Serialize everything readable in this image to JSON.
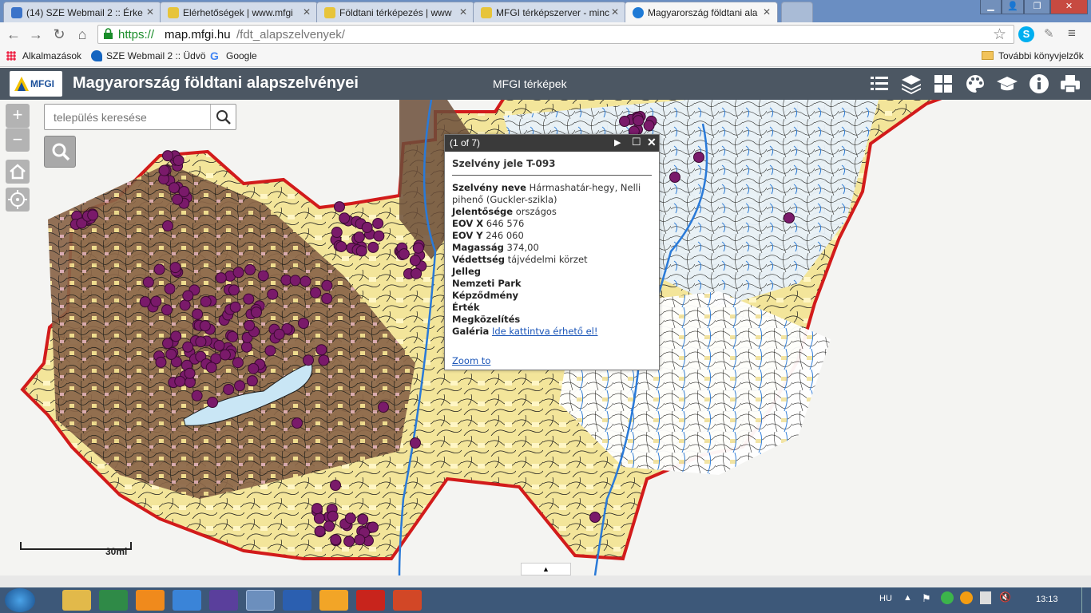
{
  "browser": {
    "tabs": [
      {
        "title": "(14) SZE Webmail 2 :: Érke",
        "active": false
      },
      {
        "title": "Elérhetőségek | www.mfgi",
        "active": false
      },
      {
        "title": "Földtani térképezés | www",
        "active": false
      },
      {
        "title": "MFGI térképszerver - minc",
        "active": false
      },
      {
        "title": "Magyarország földtani ala",
        "active": true
      }
    ],
    "url_scheme": "https://",
    "url_host": "map.mfgi.hu",
    "url_path": "/fdt_alapszelvenyek/",
    "bookmarks": [
      {
        "label": "Alkalmazások"
      },
      {
        "label": "SZE Webmail 2 :: Üdvö"
      },
      {
        "label": "Google"
      }
    ],
    "other_bookmarks": "További könyvjelzők"
  },
  "app": {
    "logo_text": "MFGI",
    "title": "Magyarország földtani alapszelvényei",
    "nav_link": "MFGI térképek",
    "toolbar_icons": [
      "list-icon",
      "layers-icon",
      "grid-icon",
      "palette-icon",
      "education-icon",
      "info-icon",
      "print-icon"
    ]
  },
  "map": {
    "zoom_in": "+",
    "zoom_out": "−",
    "search_placeholder": "település keresése",
    "scale_label": "30mi"
  },
  "popup": {
    "counter": "(1 of 7)",
    "heading_label": "Szelvény jele",
    "heading_value": "T-093",
    "fields": [
      {
        "label": "Szelvény neve",
        "value": "Hármashatár-hegy, Nelli pihenő (Guckler-szikla)"
      },
      {
        "label": "Jelentősége",
        "value": "országos"
      },
      {
        "label": "EOV X",
        "value": "646 576"
      },
      {
        "label": "EOV Y",
        "value": "246 060"
      },
      {
        "label": "Magasság",
        "value": "374,00"
      },
      {
        "label": "Védettség",
        "value": "tájvédelmi körzet"
      },
      {
        "label": "Jelleg",
        "value": ""
      },
      {
        "label": "Nemzeti Park",
        "value": ""
      },
      {
        "label": "Képződmény",
        "value": ""
      },
      {
        "label": "Érték",
        "value": ""
      },
      {
        "label": "Megközelítés",
        "value": ""
      }
    ],
    "gallery_label": "Galéria",
    "gallery_link": "Ide kattintva érhető el!",
    "zoom_link": "Zoom to"
  },
  "taskbar": {
    "language": "HU",
    "clock": "13:13"
  },
  "colors": {
    "header_bg": "#4c5763",
    "marker": "#7a1a6a",
    "border_red": "#d21b1b"
  }
}
